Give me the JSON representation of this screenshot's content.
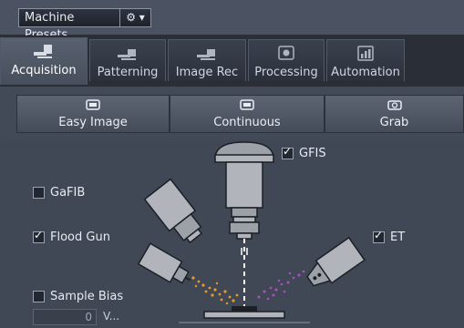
{
  "toolbar": {
    "preset_label": "Machine Presets",
    "gear_icon": "gear-icon",
    "gear_caret": "▾"
  },
  "tabs": [
    {
      "label": "Acquisition",
      "icon": "acquisition-icon",
      "active": true
    },
    {
      "label": "Patterning",
      "icon": "patterning-icon",
      "active": false
    },
    {
      "label": "Image Rec",
      "icon": "image-rec-icon",
      "active": false
    },
    {
      "label": "Processing",
      "icon": "processing-icon",
      "active": false
    },
    {
      "label": "Automation",
      "icon": "automation-icon",
      "active": false
    }
  ],
  "modes": [
    {
      "label": "Easy Image",
      "icon": "easy-image-icon"
    },
    {
      "label": "Continuous",
      "icon": "continuous-icon"
    },
    {
      "label": "Grab",
      "icon": "camera-icon"
    }
  ],
  "options": {
    "gfis": {
      "label": "GFIS",
      "checked": true
    },
    "gafib": {
      "label": "GaFIB",
      "checked": false
    },
    "flood_gun": {
      "label": "Flood Gun",
      "checked": true
    },
    "et": {
      "label": "ET",
      "checked": true
    },
    "sample_bias": {
      "label": "Sample Bias",
      "checked": false
    }
  },
  "bias": {
    "value": "0",
    "unit": "V..."
  },
  "colors": {
    "panel": "#404855",
    "ions": "#e89a2c",
    "electrons": "#b04cc8",
    "beam": "#ffffff"
  }
}
